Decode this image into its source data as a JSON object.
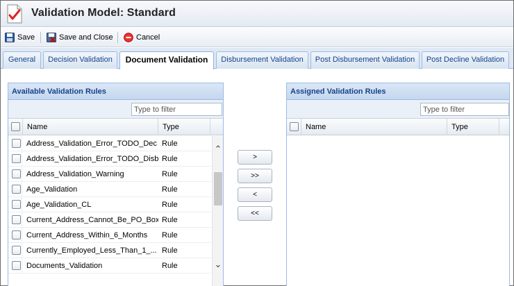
{
  "title": "Validation Model: Standard",
  "toolbar": {
    "save_label": "Save",
    "save_close_label": "Save and Close",
    "cancel_label": "Cancel"
  },
  "tabs": [
    {
      "label": "General",
      "active": false
    },
    {
      "label": "Decision Validation",
      "active": false
    },
    {
      "label": "Document Validation",
      "active": true
    },
    {
      "label": "Disbursement Validation",
      "active": false
    },
    {
      "label": "Post Disbursement Validation",
      "active": false
    },
    {
      "label": "Post Decline Validation",
      "active": false
    }
  ],
  "available": {
    "header": "Available Validation Rules",
    "filter_placeholder": "Type to filter",
    "col_name": "Name",
    "col_type": "Type",
    "rows": [
      {
        "name": "Address_Validation_Error_TODO_Dec",
        "type": "Rule"
      },
      {
        "name": "Address_Validation_Error_TODO_Disb",
        "type": "Rule"
      },
      {
        "name": "Address_Validation_Warning",
        "type": "Rule"
      },
      {
        "name": "Age_Validation",
        "type": "Rule"
      },
      {
        "name": "Age_Validation_CL",
        "type": "Rule"
      },
      {
        "name": "Current_Address_Cannot_Be_PO_Box",
        "type": "Rule"
      },
      {
        "name": "Current_Address_Within_6_Months",
        "type": "Rule"
      },
      {
        "name": "Currently_Employed_Less_Than_1_...",
        "type": "Rule"
      },
      {
        "name": "Documents_Validation",
        "type": "Rule"
      }
    ]
  },
  "assigned": {
    "header": "Assigned Validation Rules",
    "filter_placeholder": "Type to filter",
    "col_name": "Name",
    "col_type": "Type",
    "rows": []
  },
  "transfer": {
    "add_one": ">",
    "add_all": ">>",
    "remove_one": "<",
    "remove_all": "<<"
  }
}
